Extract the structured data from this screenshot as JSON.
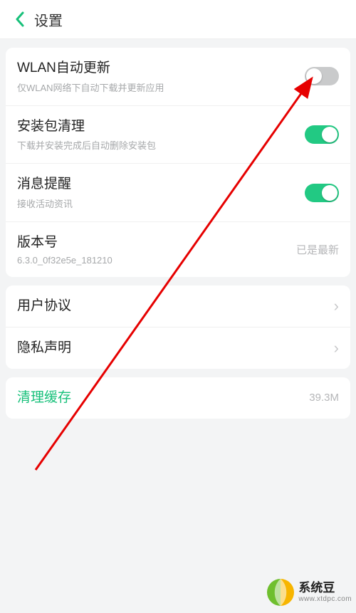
{
  "header": {
    "title": "设置"
  },
  "section1": {
    "wlan_update": {
      "title": "WLAN自动更新",
      "sub": "仅WLAN网络下自动下载并更新应用",
      "on": false
    },
    "pkg_clean": {
      "title": "安装包清理",
      "sub": "下载并安装完成后自动删除安装包",
      "on": true
    },
    "msg_notify": {
      "title": "消息提醒",
      "sub": "接收活动资讯",
      "on": true
    },
    "version": {
      "title": "版本号",
      "sub": "6.3.0_0f32e5e_181210",
      "status": "已是最新"
    }
  },
  "section2": {
    "user_agreement": {
      "title": "用户协议"
    },
    "privacy": {
      "title": "隐私声明"
    }
  },
  "section3": {
    "clear_cache": {
      "title": "清理缓存",
      "size": "39.3M"
    }
  },
  "watermark": {
    "name": "系统豆",
    "url": "www.xtdpc.com"
  }
}
